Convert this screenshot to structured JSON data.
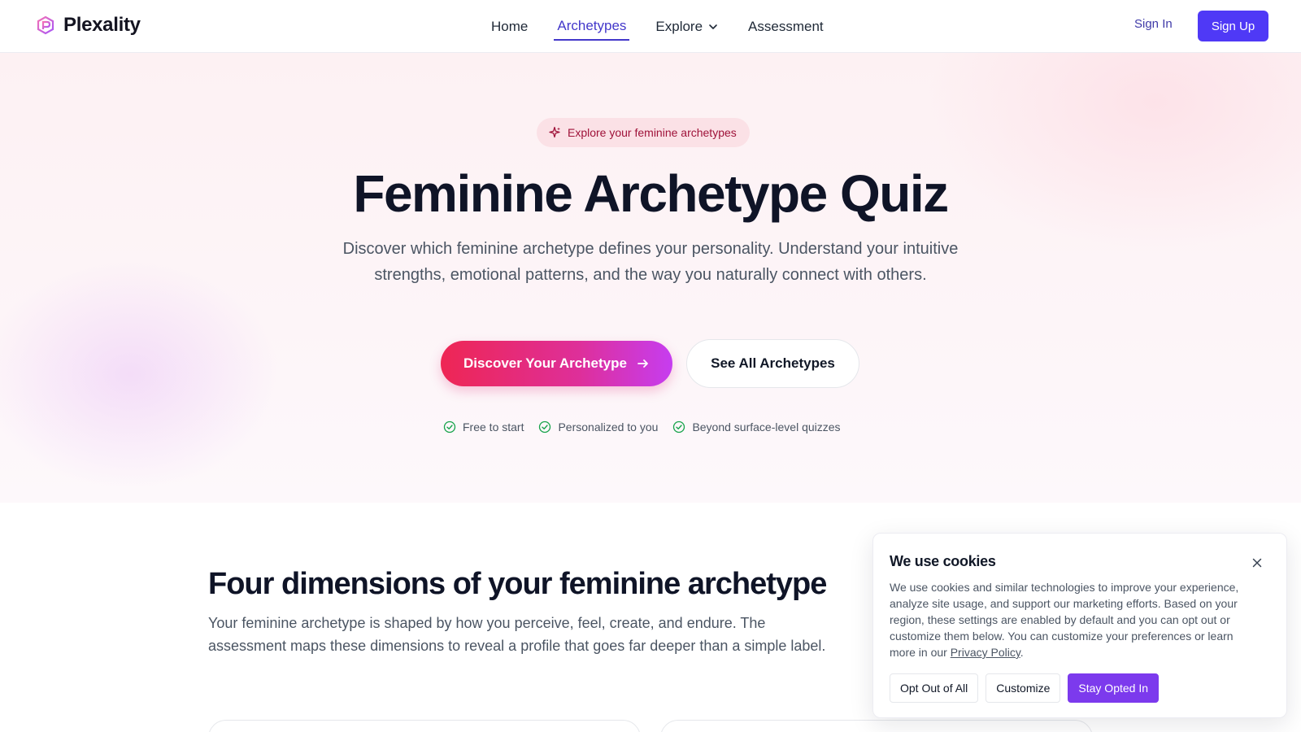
{
  "header": {
    "brand": "Plexality",
    "nav": [
      {
        "label": "Home"
      },
      {
        "label": "Archetypes"
      },
      {
        "label": "Explore"
      },
      {
        "label": "Assessment"
      }
    ],
    "sign_in": "Sign In",
    "sign_up": "Sign Up"
  },
  "hero": {
    "pill": "Explore your feminine archetypes",
    "title": "Feminine Archetype Quiz",
    "description": "Discover which feminine archetype defines your personality. Understand your intuitive strengths, emotional patterns, and the way you naturally connect with others.",
    "primary_button": "Discover Your Archetype",
    "secondary_button": "See All Archetypes",
    "features": [
      "Free to start",
      "Personalized to you",
      "Beyond surface-level quizzes"
    ]
  },
  "dimensions": {
    "title": "Four dimensions of your feminine archetype",
    "description": "Your feminine archetype is shaped by how you perceive, feel, create, and endure. The assessment maps these dimensions to reveal a profile that goes far deeper than a simple label."
  },
  "cookie": {
    "title": "We use cookies",
    "body": "We use cookies and similar technologies to improve your experience, analyze site usage, and support our marketing efforts. Based on your region, these settings are enabled by default and you can opt out or customize them below. You can customize your preferences or learn more in our ",
    "link": "Privacy Policy",
    "after_link": ".",
    "buttons": {
      "opt_out": "Opt Out of All",
      "customize": "Customize",
      "stay": "Stay Opted In"
    }
  },
  "colors": {
    "accent": "#4f39f6",
    "pink": "#ee2654",
    "purple": "#7c3aed",
    "check": "#16a34a"
  }
}
